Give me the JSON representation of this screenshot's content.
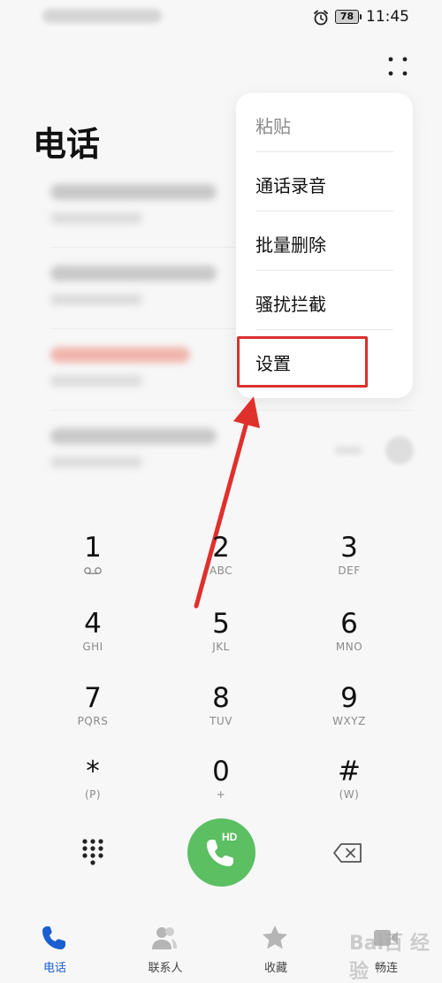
{
  "status_bar": {
    "time": "11:45",
    "battery": "78"
  },
  "header": {
    "title": "电话"
  },
  "menu": {
    "items": [
      {
        "label": "粘贴",
        "enabled": false
      },
      {
        "label": "通话录音",
        "enabled": true
      },
      {
        "label": "批量删除",
        "enabled": true
      },
      {
        "label": "骚扰拦截",
        "enabled": true
      },
      {
        "label": "设置",
        "enabled": true,
        "highlighted": true
      }
    ]
  },
  "dialpad": {
    "keys": [
      {
        "digit": "1",
        "letters": ""
      },
      {
        "digit": "2",
        "letters": "ABC"
      },
      {
        "digit": "3",
        "letters": "DEF"
      },
      {
        "digit": "4",
        "letters": "GHI"
      },
      {
        "digit": "5",
        "letters": "JKL"
      },
      {
        "digit": "6",
        "letters": "MNO"
      },
      {
        "digit": "7",
        "letters": "PQRS"
      },
      {
        "digit": "8",
        "letters": "TUV"
      },
      {
        "digit": "9",
        "letters": "WXYZ"
      },
      {
        "digit": "*",
        "letters": "(P)"
      },
      {
        "digit": "0",
        "letters": "+"
      },
      {
        "digit": "#",
        "letters": "(W)"
      }
    ],
    "call_badge": "HD"
  },
  "bottom_nav": {
    "items": [
      {
        "label": "电话",
        "icon": "phone-icon",
        "active": true
      },
      {
        "label": "联系人",
        "icon": "contacts-icon",
        "active": false
      },
      {
        "label": "收藏",
        "icon": "star-icon",
        "active": false
      },
      {
        "label": "畅连",
        "icon": "meetime-icon",
        "active": false
      }
    ]
  },
  "watermark": "Bai百 经验",
  "colors": {
    "accent_blue": "#1a5fd0",
    "call_green": "#5cbf62",
    "highlight_red": "#d9312d"
  }
}
